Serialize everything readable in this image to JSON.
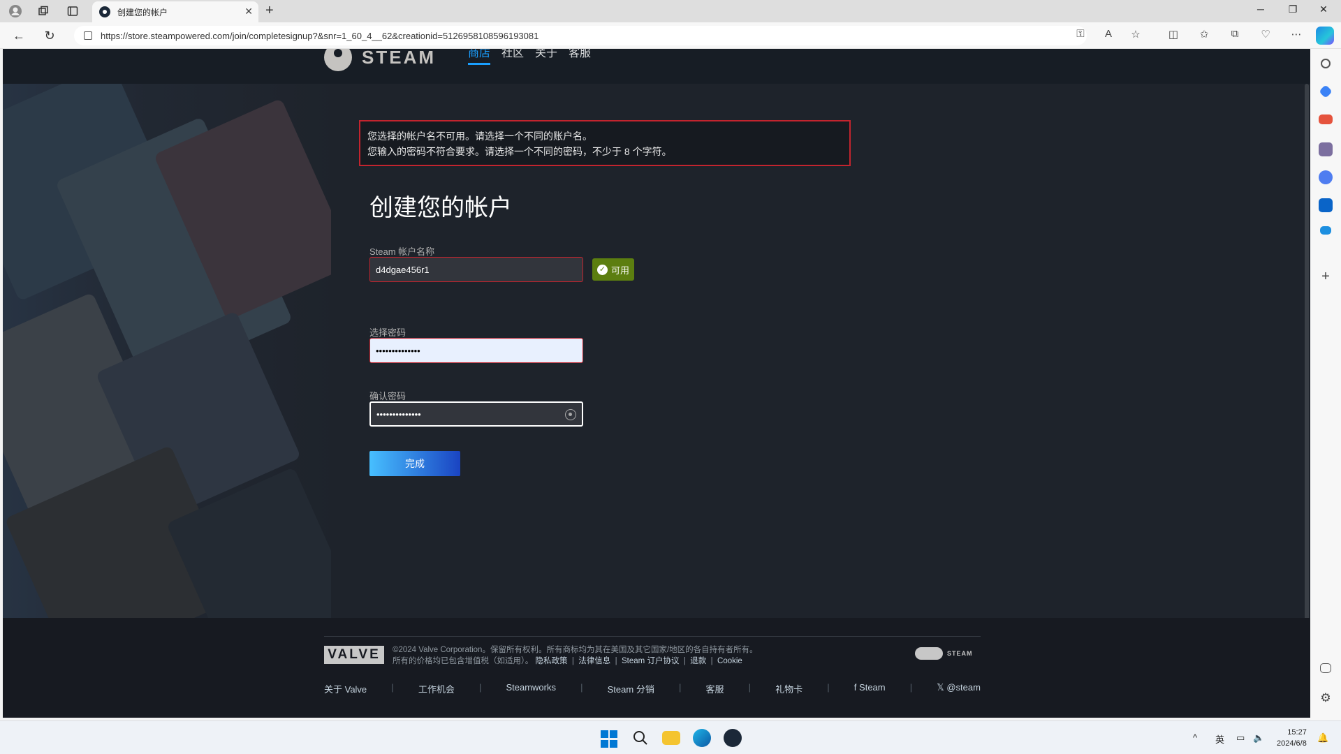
{
  "browser": {
    "tab_title": "创建您的帐户",
    "url": "https://store.steampowered.com/join/completesignup?&snr=1_60_4__62&creationid=5126958108596193081"
  },
  "steam": {
    "logo_text": "STEAM",
    "nav": [
      "商店",
      "社区",
      "关于",
      "客服"
    ]
  },
  "form": {
    "errors": [
      "您选择的帐户名不可用。请选择一个不同的账户名。",
      "您输入的密码不符合要求。请选择一个不同的密码，不少于 8 个字符。"
    ],
    "title": "创建您的帐户",
    "username_label": "Steam 帐户名称",
    "username_value": "d4dgae456r1",
    "available_label": "可用",
    "password_label": "选择密码",
    "password_value": "••••••••••••••",
    "confirm_label": "确认密码",
    "confirm_value": "••••••••••••••",
    "submit_label": "完成"
  },
  "footer": {
    "valve_logo": "VALVE",
    "copyright": "©2024 Valve Corporation。保留所有权利。所有商标均为其在美国及其它国家/地区的各自持有者所有。",
    "vat_note": "所有的价格均已包含增值税（如适用）。",
    "legal_links": [
      "隐私政策",
      "法律信息",
      "Steam 订户协议",
      "退款",
      "Cookie"
    ],
    "steam_mark": "STEAM",
    "links": [
      "关于 Valve",
      "工作机会",
      "Steamworks",
      "Steam 分销",
      "客服",
      "礼物卡",
      "Steam",
      "@steam"
    ]
  },
  "taskbar": {
    "ime": "英",
    "time": "15:27",
    "date": "2024/6/8"
  }
}
